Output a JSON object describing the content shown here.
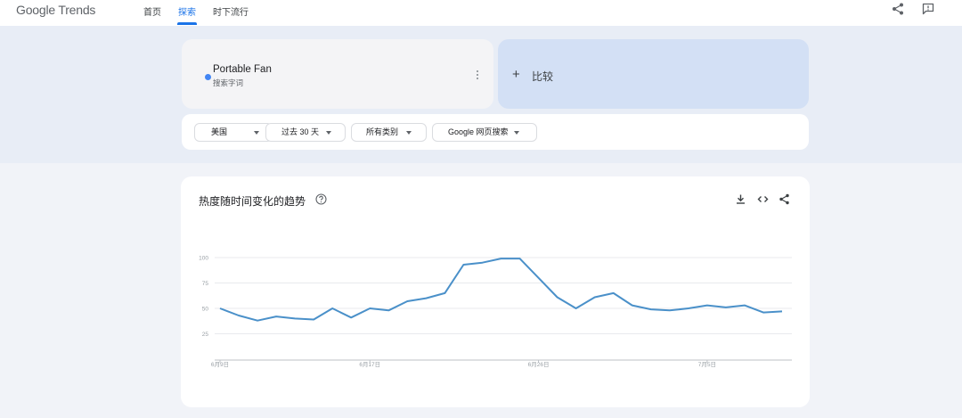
{
  "header": {
    "logo": "Google Trends",
    "nav": [
      {
        "label": "首页"
      },
      {
        "label": "探索"
      },
      {
        "label": "时下流行"
      }
    ],
    "icons": [
      "share-icon",
      "feedback-icon"
    ]
  },
  "term": {
    "name": "Portable Fan",
    "type": "搜索字词",
    "color": "#4285f4"
  },
  "compare": {
    "label": "比较"
  },
  "filters": [
    {
      "label": "美国"
    },
    {
      "label": "过去 30 天"
    },
    {
      "label": "所有类别"
    },
    {
      "label": "Google 网页搜索"
    }
  ],
  "chart_card": {
    "title": "热度随时间变化的趋势",
    "icons": [
      "help-icon",
      "download-icon",
      "embed-icon",
      "share-icon"
    ]
  },
  "chart_data": {
    "type": "line",
    "x_tick_labels": [
      "6月9日",
      "6月17日",
      "6月26日",
      "7月5日"
    ],
    "y_ticks": [
      25,
      50,
      75,
      100
    ],
    "ylim": [
      0,
      100
    ],
    "grid": true,
    "series": [
      {
        "name": "Portable Fan",
        "color": "#4a90c9",
        "values": [
          50,
          43,
          38,
          42,
          40,
          39,
          50,
          41,
          50,
          48,
          57,
          60,
          65,
          93,
          95,
          99,
          99,
          80,
          61,
          50,
          61,
          65,
          53,
          49,
          48,
          50,
          53,
          51,
          53,
          46,
          47
        ]
      }
    ]
  }
}
